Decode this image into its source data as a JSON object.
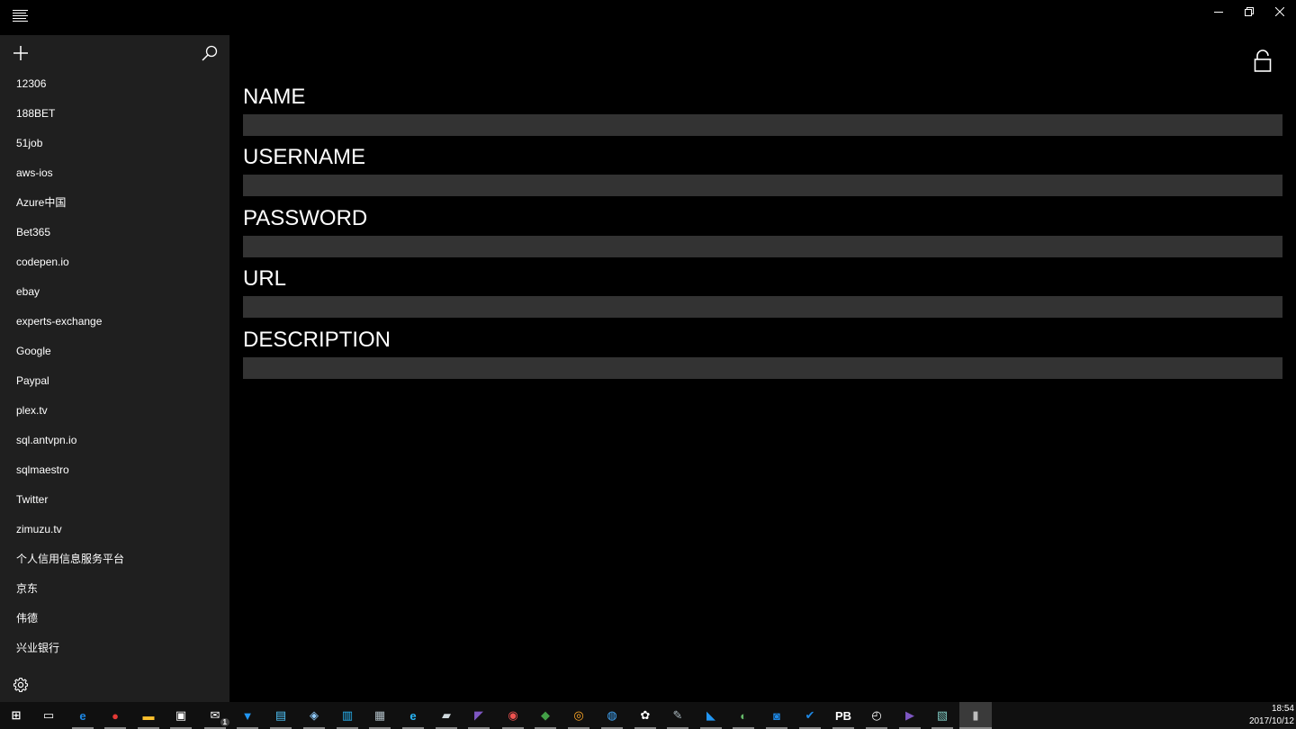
{
  "titlebar": {
    "menu_icon": "hamburger-icon",
    "controls": [
      "minimize-icon",
      "maximize-icon",
      "close-icon"
    ]
  },
  "sidebar": {
    "add_icon": "plus-icon",
    "search_icon": "search-icon",
    "settings_icon": "gear-icon",
    "items": [
      {
        "label": "12306"
      },
      {
        "label": "188BET"
      },
      {
        "label": "51job"
      },
      {
        "label": "aws-ios"
      },
      {
        "label": "Azure中国"
      },
      {
        "label": "Bet365"
      },
      {
        "label": "codepen.io"
      },
      {
        "label": "ebay"
      },
      {
        "label": "experts-exchange"
      },
      {
        "label": "Google"
      },
      {
        "label": "Paypal"
      },
      {
        "label": "plex.tv"
      },
      {
        "label": "sql.antvpn.io"
      },
      {
        "label": "sqlmaestro"
      },
      {
        "label": "Twitter"
      },
      {
        "label": "zimuzu.tv"
      },
      {
        "label": "个人信用信息服务平台"
      },
      {
        "label": "京东"
      },
      {
        "label": "伟德"
      },
      {
        "label": "兴业银行"
      }
    ]
  },
  "main": {
    "lock_icon": "lock-icon",
    "fields": [
      {
        "label": "NAME",
        "value": ""
      },
      {
        "label": "USERNAME",
        "value": ""
      },
      {
        "label": "PASSWORD",
        "value": ""
      },
      {
        "label": "URL",
        "value": ""
      },
      {
        "label": "DESCRIPTION",
        "value": ""
      }
    ]
  },
  "taskbar": {
    "apps": [
      {
        "name": "start-icon",
        "color": "#ffffff"
      },
      {
        "name": "task-view-icon",
        "color": "#ffffff"
      },
      {
        "name": "edge-icon",
        "color": "#1e88e5"
      },
      {
        "name": "chrome-icon",
        "color": "#e53935"
      },
      {
        "name": "file-explorer-icon",
        "color": "#fbc02d"
      },
      {
        "name": "store-icon",
        "color": "#ffffff"
      },
      {
        "name": "mail-icon",
        "color": "#ffffff"
      },
      {
        "name": "app-blue-icon",
        "color": "#2196f3"
      },
      {
        "name": "app-terminal-icon",
        "color": "#4fc3f7"
      },
      {
        "name": "app-network-icon",
        "color": "#90caf9"
      },
      {
        "name": "app-azure-icon",
        "color": "#29b6f6"
      },
      {
        "name": "app-printer-icon",
        "color": "#b0bec5"
      },
      {
        "name": "ie-icon",
        "color": "#29b6f6"
      },
      {
        "name": "app-remote-icon",
        "color": "#cfd8dc"
      },
      {
        "name": "visual-studio-icon",
        "color": "#7e57c2"
      },
      {
        "name": "app-paint-icon",
        "color": "#ef5350"
      },
      {
        "name": "app-diamond-icon",
        "color": "#43a047"
      },
      {
        "name": "app-orange-icon",
        "color": "#ffa726"
      },
      {
        "name": "app-globe-icon",
        "color": "#42a5f5"
      },
      {
        "name": "app-photos-icon",
        "color": "#ffffff"
      },
      {
        "name": "app-wrench-icon",
        "color": "#b0bec5"
      },
      {
        "name": "vscode-icon",
        "color": "#2196f3"
      },
      {
        "name": "app-search-icon",
        "color": "#66bb6a"
      },
      {
        "name": "app-dropbox-icon",
        "color": "#1e88e5"
      },
      {
        "name": "todo-icon",
        "color": "#1e88e5"
      },
      {
        "name": "app-pb-icon",
        "color": "#ffffff"
      },
      {
        "name": "alarms-icon",
        "color": "#ffffff"
      },
      {
        "name": "app-play-icon",
        "color": "#7e57c2"
      },
      {
        "name": "app-notes-icon",
        "color": "#80cbc4"
      },
      {
        "name": "app-current-icon",
        "color": "#bdbdbd"
      }
    ],
    "mail_badge": "1",
    "time": "18:54",
    "date": "2017/10/12"
  }
}
